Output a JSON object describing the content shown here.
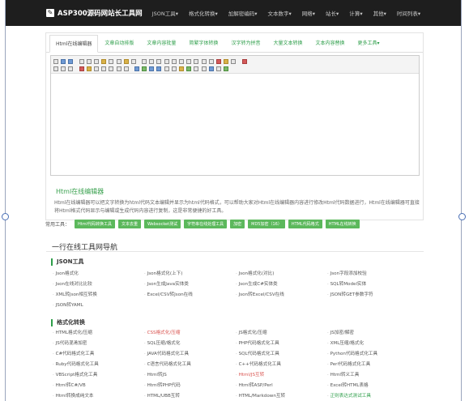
{
  "nav": {
    "logo": "ASP300源码网站长工具网",
    "items": [
      "JSON工具▾",
      "格式化转换▾",
      "加解密编码▾",
      "文本数字▾",
      "网络▾",
      "站长▾",
      "计算▾",
      "其他▾",
      "时间列表▾"
    ]
  },
  "tabs": [
    "Html在线编辑器",
    "文章自动排版",
    "文章内容批量",
    "简繁字体转换",
    "汉字转为拼音",
    "大量文本转换",
    "文本内容替换",
    "更多工具▾"
  ],
  "intro": {
    "title": "Html在线编辑器",
    "text": "Html在线编辑器可以把文字转换为html代码文本编辑并显示为html代码格式，可以帮助大家对Html在线编辑器内容进行修改Html代码数据进行，Html在线编辑器可直接将Html格式代码显示与编辑或生成代码内容进行复制，这是非常便捷的好工具。"
  },
  "tools": {
    "label": "常用工具：",
    "buttons": [
      "Html代码转换工具",
      "文本去重",
      "Websocket测试",
      "字符串在线处理工具",
      "加密",
      "MD5加密（16）",
      "HTML代码格式",
      "HTML在线转换"
    ]
  },
  "section_title": "一行在线工具网导航",
  "categories": [
    {
      "title": "JSON工具",
      "items": [
        {
          "label": "Json格式化"
        },
        {
          "label": "Json格式化(上下)"
        },
        {
          "label": "Json格式化(对比)"
        },
        {
          "label": "Json字段添加校验"
        },
        {
          "label": "Json在线对比比较"
        },
        {
          "label": "Json生成Java实体类"
        },
        {
          "label": "Json生成C#实体类"
        },
        {
          "label": "SQL转Model实体"
        },
        {
          "label": "XML转Json相互转换"
        },
        {
          "label": "Excel/CSV转Json在线"
        },
        {
          "label": "Json转Excel/CSV在线"
        },
        {
          "label": "JSON转GET参数字符"
        },
        {
          "label": "JSON转YAML"
        }
      ]
    },
    {
      "title": "格式化转换",
      "items": [
        {
          "label": "HTML格式化/压缩"
        },
        {
          "label": "CSS格式化/压缩",
          "state": "red"
        },
        {
          "label": "JS格式化/压缩"
        },
        {
          "label": "JS加密/解密"
        },
        {
          "label": "JS代码混淆加密"
        },
        {
          "label": "SQL压缩/格式化"
        },
        {
          "label": "PHP代码格式化工具"
        },
        {
          "label": "XML压缩/格式化"
        },
        {
          "label": "C#代码格式化工具"
        },
        {
          "label": "JAVA代码格式化工具"
        },
        {
          "label": "SQL代码格式化工具"
        },
        {
          "label": "Python代码格式化工具"
        },
        {
          "label": "Ruby代码格式化工具"
        },
        {
          "label": "C语言代码格式化工具"
        },
        {
          "label": "C++代码格式化工具"
        },
        {
          "label": "Perl代码格式化工具"
        },
        {
          "label": "VBScript格式化工具"
        },
        {
          "label": "Html转JS"
        },
        {
          "label": "Html/JS互转",
          "state": "red"
        },
        {
          "label": "Html转义工具"
        },
        {
          "label": "Html转C#/VB"
        },
        {
          "label": "Html转PHP代码"
        },
        {
          "label": "Html转ASP/Perl"
        },
        {
          "label": "Excel转HTML表格"
        },
        {
          "label": "Html转换成纯文本"
        },
        {
          "label": "HTML/UBB互转"
        },
        {
          "label": "HTML/Markdown互转"
        },
        {
          "label": "正则表达式测试工具",
          "state": "green"
        }
      ]
    }
  ]
}
